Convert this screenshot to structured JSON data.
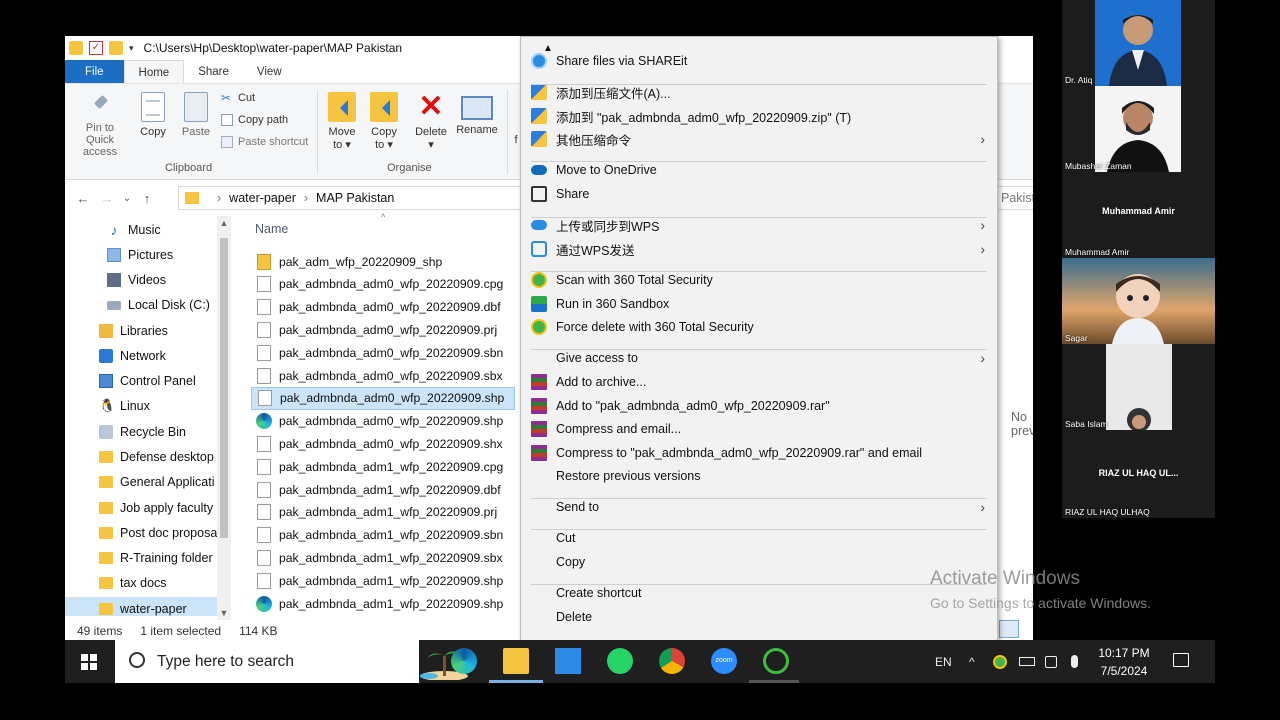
{
  "window": {
    "path": "C:\\Users\\Hp\\Desktop\\water-paper\\MAP Pakistan"
  },
  "ribbon": {
    "tabs": [
      "File",
      "Home",
      "Share",
      "View"
    ],
    "pin": "Pin to Quick",
    "pin2": "access",
    "copy": "Copy",
    "paste": "Paste",
    "cut": "Cut",
    "copy_path": "Copy path",
    "paste_shortcut": "Paste shortcut",
    "clipboard_group": "Clipboard",
    "move_to": "Move",
    "move_to2": "to ▾",
    "copy_to": "Copy",
    "copy_to2": "to ▾",
    "delete": "Delete",
    "rename": "Rename",
    "organise_group": "Organise",
    "truncated_f": "f"
  },
  "address": {
    "crumbs": [
      "water-paper",
      "MAP Pakistan"
    ],
    "search_partial": "Pakistan"
  },
  "nav": {
    "items": [
      {
        "label": "Music",
        "icon": "music-icon"
      },
      {
        "label": "Pictures",
        "icon": "pictures-icon"
      },
      {
        "label": "Videos",
        "icon": "videos-icon"
      },
      {
        "label": "Local Disk (C:)",
        "icon": "disk-icon"
      },
      {
        "label": "Libraries",
        "icon": "libraries-icon"
      },
      {
        "label": "Network",
        "icon": "network-icon"
      },
      {
        "label": "Control Panel",
        "icon": "control-panel-icon"
      },
      {
        "label": "Linux",
        "icon": "linux-icon"
      },
      {
        "label": "Recycle Bin",
        "icon": "recycle-bin-icon"
      },
      {
        "label": "Defense desktop",
        "icon": "folder-icon"
      },
      {
        "label": "General Applicati",
        "icon": "folder-icon"
      },
      {
        "label": "Job apply faculty",
        "icon": "folder-icon"
      },
      {
        "label": "Post doc proposa",
        "icon": "folder-icon"
      },
      {
        "label": "R-Training folder",
        "icon": "folder-icon"
      },
      {
        "label": "tax docs",
        "icon": "folder-icon"
      },
      {
        "label": "water-paper",
        "icon": "folder-icon"
      }
    ]
  },
  "files": {
    "column_name": "Name",
    "rows": [
      {
        "name": "pak_adm_wfp_20220909_shp",
        "type": "zip"
      },
      {
        "name": "pak_admbnda_adm0_wfp_20220909.cpg",
        "type": "doc"
      },
      {
        "name": "pak_admbnda_adm0_wfp_20220909.dbf",
        "type": "doc"
      },
      {
        "name": "pak_admbnda_adm0_wfp_20220909.prj",
        "type": "doc"
      },
      {
        "name": "pak_admbnda_adm0_wfp_20220909.sbn",
        "type": "doc"
      },
      {
        "name": "pak_admbnda_adm0_wfp_20220909.sbx",
        "type": "doc"
      },
      {
        "name": "pak_admbnda_adm0_wfp_20220909.shp",
        "type": "doc"
      },
      {
        "name": "pak_admbnda_adm0_wfp_20220909.shp",
        "type": "edge"
      },
      {
        "name": "pak_admbnda_adm0_wfp_20220909.shx",
        "type": "doc"
      },
      {
        "name": "pak_admbnda_adm1_wfp_20220909.cpg",
        "type": "doc"
      },
      {
        "name": "pak_admbnda_adm1_wfp_20220909.dbf",
        "type": "doc"
      },
      {
        "name": "pak_admbnda_adm1_wfp_20220909.prj",
        "type": "doc"
      },
      {
        "name": "pak_admbnda_adm1_wfp_20220909.sbn",
        "type": "doc"
      },
      {
        "name": "pak_admbnda_adm1_wfp_20220909.sbx",
        "type": "doc"
      },
      {
        "name": "pak_admbnda_adm1_wfp_20220909.shp",
        "type": "doc"
      },
      {
        "name": "pak_admbnda_adm1_wfp_20220909.shp",
        "type": "edge"
      }
    ],
    "selected_index": 6
  },
  "preview_text": "No previe",
  "status": {
    "count": "49 items",
    "selected": "1 item selected",
    "size": "114 KB"
  },
  "menu": {
    "items": [
      {
        "label": "Share files via SHAREit",
        "icon": "shareit-icon"
      },
      {
        "label": "添加到压缩文件(A)...",
        "icon": "bandizip-icon"
      },
      {
        "label": "添加到 \"pak_admbnda_adm0_wfp_20220909.zip\" (T)",
        "icon": "bandizip-icon"
      },
      {
        "label": "其他压缩命令",
        "icon": "bandizip-icon",
        "submenu": true
      },
      {
        "label": "Move to OneDrive",
        "icon": "onedrive-icon"
      },
      {
        "label": "Share",
        "icon": "share-icon"
      },
      {
        "label": "上传或同步到WPS",
        "icon": "wps-cloud-icon",
        "submenu": true
      },
      {
        "label": "通过WPS发送",
        "icon": "wps-send-icon",
        "submenu": true
      },
      {
        "label": "Scan with 360 Total Security",
        "icon": "total-security-icon"
      },
      {
        "label": "Run in 360 Sandbox",
        "icon": "sandbox-icon"
      },
      {
        "label": "Force delete with 360 Total Security",
        "icon": "total-security-icon"
      },
      {
        "label": "Give access to",
        "icon": "",
        "submenu": true
      },
      {
        "label": "Add to archive...",
        "icon": "winrar-icon"
      },
      {
        "label": "Add to \"pak_admbnda_adm0_wfp_20220909.rar\"",
        "icon": "winrar-icon"
      },
      {
        "label": "Compress and email...",
        "icon": "winrar-icon"
      },
      {
        "label": "Compress to \"pak_admbnda_adm0_wfp_20220909.rar\" and email",
        "icon": "winrar-icon"
      },
      {
        "label": "Restore previous versions",
        "icon": ""
      },
      {
        "label": "Send to",
        "icon": "",
        "submenu": true
      },
      {
        "label": "Cut",
        "icon": ""
      },
      {
        "label": "Copy",
        "icon": ""
      },
      {
        "label": "Create shortcut",
        "icon": ""
      },
      {
        "label": "Delete",
        "icon": ""
      }
    ]
  },
  "watermark": {
    "line1": "Activate Windows",
    "line2": "Go to Settings to activate Windows."
  },
  "taskbar": {
    "search_placeholder": "Type here to search",
    "lang": "EN",
    "time": "10:17 PM",
    "date": "7/5/2024",
    "zoom_label": "zoom"
  },
  "participants": [
    {
      "name": "Dr. Atiq",
      "video": true
    },
    {
      "name": "Mubasher Zaman",
      "video": true
    },
    {
      "name": "Muhammad Amir",
      "big": "Muhammad Amir",
      "video": false
    },
    {
      "name": "Sagar",
      "video": true
    },
    {
      "name": "Saba Islam",
      "video": true
    },
    {
      "name": "RIAZ UL HAQ ULHAQ",
      "big": "RIAZ UL HAQ UL...",
      "video": false
    }
  ]
}
